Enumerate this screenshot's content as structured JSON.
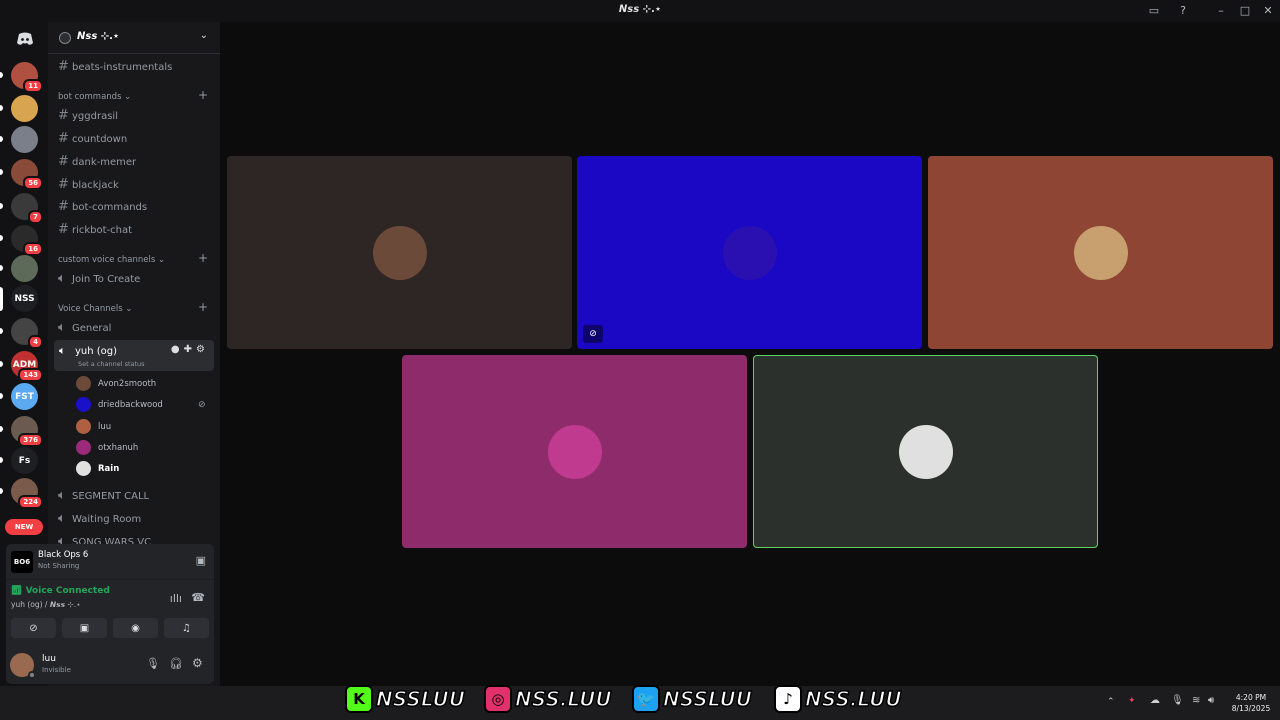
{
  "window": {
    "title": "𝙉𝙨𝙨 ⊹.⋆"
  },
  "servers": [
    {
      "badge": "11",
      "color": "#b05040"
    },
    {
      "badge": "",
      "color": "#d9a450"
    },
    {
      "badge": "",
      "color": "#7a7f8a"
    },
    {
      "badge": "56",
      "color": "#8a4a3a"
    },
    {
      "badge": "7",
      "color": "#3a3a3a"
    },
    {
      "badge": "16",
      "color": "#2a2a2a"
    },
    {
      "badge": "",
      "color": "#5d6a5a"
    },
    {
      "badge": "",
      "color": "#1e1f22",
      "label": "NSS"
    },
    {
      "badge": "4",
      "color": "#444"
    },
    {
      "badge": "143",
      "color": "#c03030",
      "label": "ADM"
    },
    {
      "badge": "",
      "color": "#5ba9f0",
      "label": "FST"
    },
    {
      "badge": "376",
      "color": "#6a5a50"
    },
    {
      "badge": "",
      "color": "#1e1f22",
      "label": "Fs"
    },
    {
      "badge": "224",
      "color": "#7a5a4a"
    }
  ],
  "new_badge": "NEW",
  "guild": {
    "name": "𝙉𝙨𝙨 ⊹.⋆"
  },
  "channels": {
    "top": "beats-instrumentals",
    "bot_category": "bot commands",
    "bot_channels": [
      "yggdrasil",
      "countdown",
      "dank-memer",
      "blackjack",
      "bot-commands",
      "rickbot-chat"
    ],
    "custom_category": "custom voice channels",
    "custom_channels": [
      "Join To Create"
    ],
    "voice_category": "Voice Channels",
    "general": "General",
    "active_channel": "yuh (og)",
    "status_placeholder": "Set a channel status",
    "members": [
      {
        "name": "Avon2smooth",
        "color": "#6b4a3a",
        "bold": false
      },
      {
        "name": "driedbackwood",
        "color": "#1a10c8",
        "bold": false
      },
      {
        "name": "luu",
        "color": "#b06040",
        "bold": false
      },
      {
        "name": "otxhanuh",
        "color": "#9c2a7a",
        "bold": false
      },
      {
        "name": "Rain",
        "color": "#e0e0e0",
        "bold": true
      }
    ],
    "after": [
      "SEGMENT CALL",
      "Waiting Room",
      "SONG WARS VC"
    ]
  },
  "activity": {
    "game": "Black Ops 6",
    "status": "Not Sharing",
    "logo": "BO6"
  },
  "voice": {
    "status": "Voice Connected",
    "location": "yuh (og) / 𝙉𝙨𝙨 ⊹.⋆"
  },
  "user": {
    "name": "luu",
    "status": "Invisible"
  },
  "tiles": [
    {
      "color": "#2e2624",
      "avatar": "#6b4a3a"
    },
    {
      "color": "#1a08c4",
      "avatar": "#2a10b0"
    },
    {
      "color": "#8e4533",
      "avatar": "#c8a070"
    },
    {
      "color": "#8e2b6b",
      "avatar": "#c03a90"
    },
    {
      "color": "#2b302c",
      "avatar": "#e0e0e0",
      "speaking": true
    }
  ],
  "socials": [
    {
      "logo": "K",
      "handle": "NSSLUU",
      "color": "#53fc18"
    },
    {
      "logo": "◎",
      "handle": "NSS.LUU",
      "color": "#e1306c"
    },
    {
      "logo": "🐦",
      "handle": "NSSLUU",
      "color": "#1da1f2"
    },
    {
      "logo": "♪",
      "handle": "NSS.LUU",
      "color": "#ffffff"
    }
  ],
  "clock": {
    "time": "4:20 PM",
    "date": "8/13/2025"
  }
}
